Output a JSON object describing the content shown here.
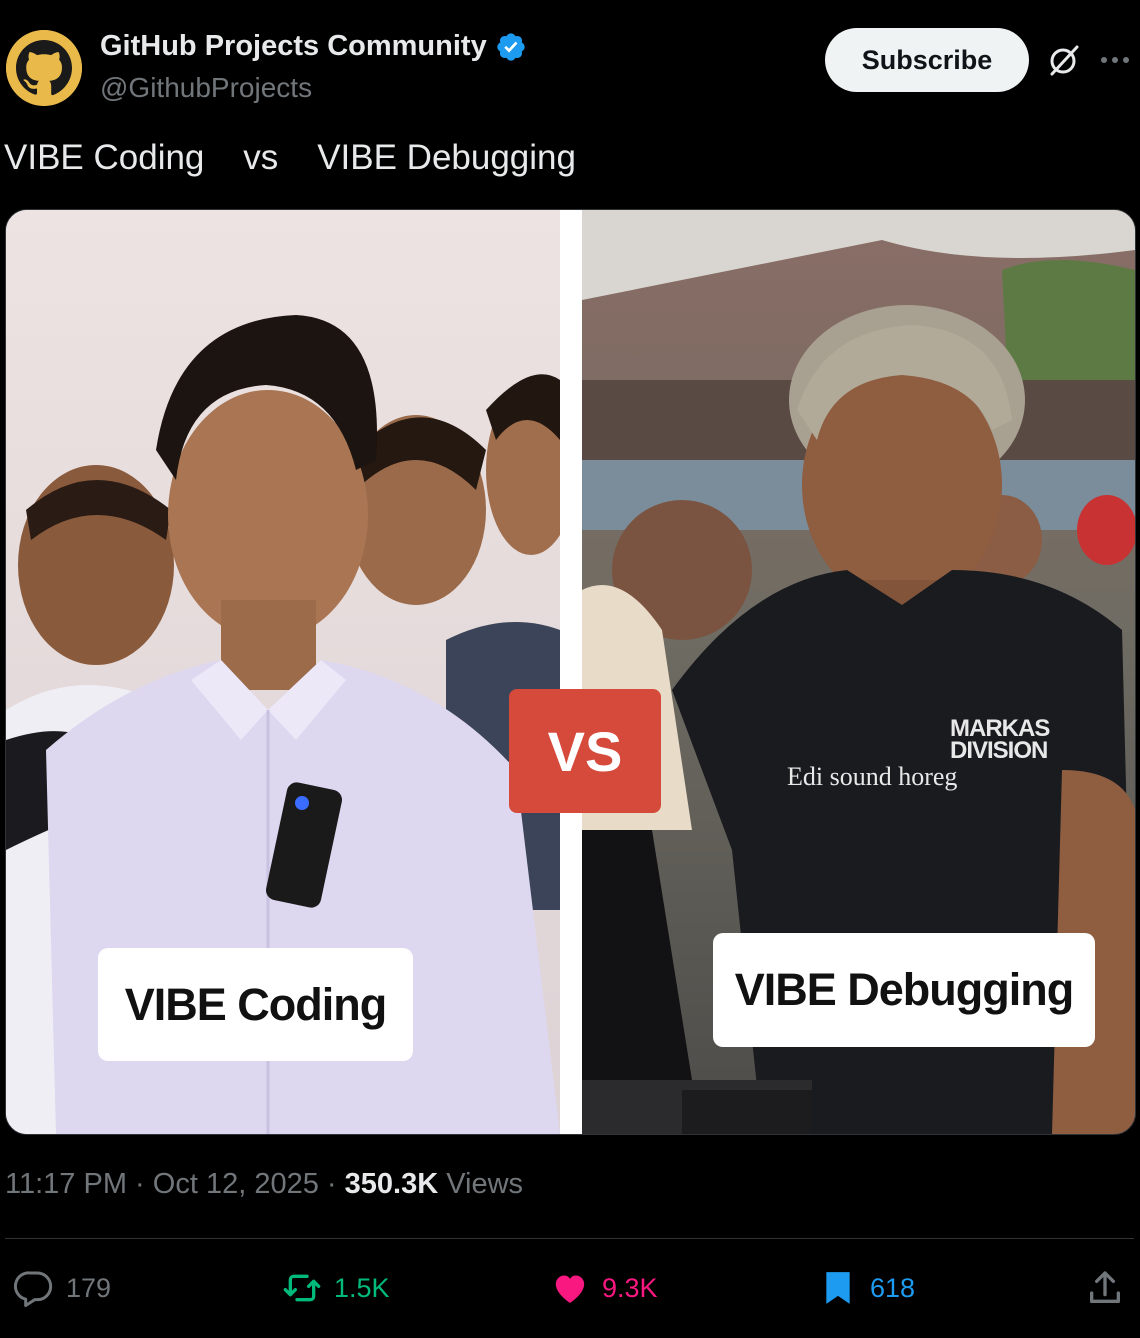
{
  "author": {
    "display_name": "GitHub Projects Community",
    "handle": "@GithubProjects",
    "verified_icon": "verified-badge-icon",
    "avatar_icon": "github-octocat-icon"
  },
  "header_actions": {
    "subscribe_label": "Subscribe",
    "grok_icon": "grok-icon",
    "more_icon": "more-icon"
  },
  "post": {
    "text": "VIBE Coding    vs    VIBE Debugging"
  },
  "media": {
    "left_caption": "VIBE Coding",
    "right_caption": "VIBE Debugging",
    "vs_label": "VS",
    "shirt_brand_line1": "MARKAS",
    "shirt_brand_line2": "DIVISION",
    "watermark": "Edi sound horeg"
  },
  "meta": {
    "time": "11:17 PM",
    "separator": "·",
    "date": "Oct 12, 2025",
    "views_count": "350.3K",
    "views_label": "Views"
  },
  "actions": {
    "replies": "179",
    "reposts": "1.5K",
    "likes": "9.3K",
    "bookmarks": "618"
  },
  "colors": {
    "verified": "#1d9bf0",
    "repost": "#00ba7c",
    "like": "#f91880",
    "bookmark": "#1d9bf0",
    "muted": "#71767b",
    "vs_badge": "#d64a3c"
  }
}
